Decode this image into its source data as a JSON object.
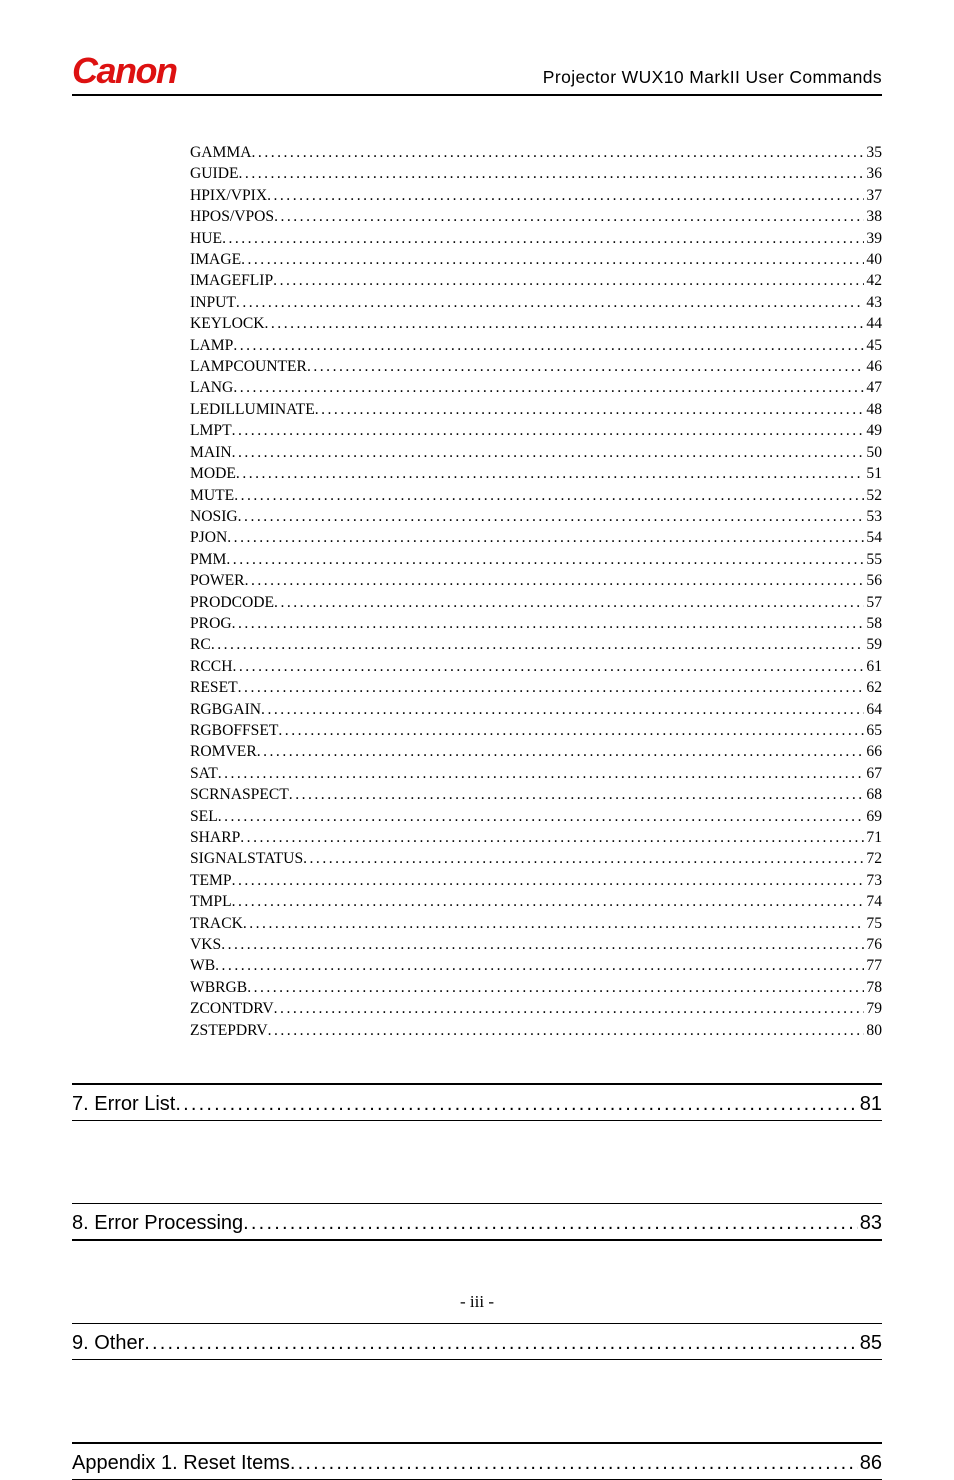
{
  "header": {
    "brand": "Canon",
    "title": "Projector  WUX10  MarkII  User  Commands"
  },
  "toc": [
    {
      "label": "GAMMA",
      "page": "35"
    },
    {
      "label": "GUIDE",
      "page": "36"
    },
    {
      "label": "HPIX/VPIX",
      "page": "37"
    },
    {
      "label": "HPOS/VPOS",
      "page": "38"
    },
    {
      "label": "HUE",
      "page": "39"
    },
    {
      "label": "IMAGE",
      "page": "40"
    },
    {
      "label": "IMAGEFLIP",
      "page": "42"
    },
    {
      "label": "INPUT",
      "page": "43"
    },
    {
      "label": "KEYLOCK",
      "page": "44"
    },
    {
      "label": "LAMP",
      "page": "45"
    },
    {
      "label": "LAMPCOUNTER",
      "page": "46"
    },
    {
      "label": "LANG",
      "page": "47"
    },
    {
      "label": "LEDILLUMINATE",
      "page": "48"
    },
    {
      "label": "LMPT",
      "page": "49"
    },
    {
      "label": "MAIN",
      "page": "50"
    },
    {
      "label": "MODE",
      "page": "51"
    },
    {
      "label": "MUTE",
      "page": "52"
    },
    {
      "label": "NOSIG",
      "page": "53"
    },
    {
      "label": "PJON",
      "page": "54"
    },
    {
      "label": "PMM",
      "page": "55"
    },
    {
      "label": "POWER",
      "page": "56"
    },
    {
      "label": "PRODCODE",
      "page": "57"
    },
    {
      "label": "PROG",
      "page": "58"
    },
    {
      "label": "RC",
      "page": "59"
    },
    {
      "label": "RCCH",
      "page": "61"
    },
    {
      "label": "RESET",
      "page": "62"
    },
    {
      "label": "RGBGAIN",
      "page": "64"
    },
    {
      "label": "RGBOFFSET",
      "page": "65"
    },
    {
      "label": "ROMVER",
      "page": "66"
    },
    {
      "label": "SAT",
      "page": "67"
    },
    {
      "label": "SCRNASPECT",
      "page": "68"
    },
    {
      "label": "SEL",
      "page": "69"
    },
    {
      "label": "SHARP",
      "page": "71"
    },
    {
      "label": "SIGNALSTATUS",
      "page": "72"
    },
    {
      "label": "TEMP",
      "page": "73"
    },
    {
      "label": "TMPL",
      "page": "74"
    },
    {
      "label": "TRACK",
      "page": "75"
    },
    {
      "label": "VKS",
      "page": "76"
    },
    {
      "label": "WB",
      "page": "77"
    },
    {
      "label": "WBRGB",
      "page": "78"
    },
    {
      "label": "ZCONTDRV",
      "page": "79"
    },
    {
      "label": "ZSTEPDRV",
      "page": "80"
    }
  ],
  "sections": [
    {
      "label": "7. Error List",
      "page": "81"
    },
    {
      "label": "8. Error Processing",
      "page": "83"
    },
    {
      "label": "9. Other ",
      "page": "85"
    },
    {
      "label": "Appendix 1. Reset Items ",
      "page": "86"
    }
  ],
  "footer": "- iii -"
}
